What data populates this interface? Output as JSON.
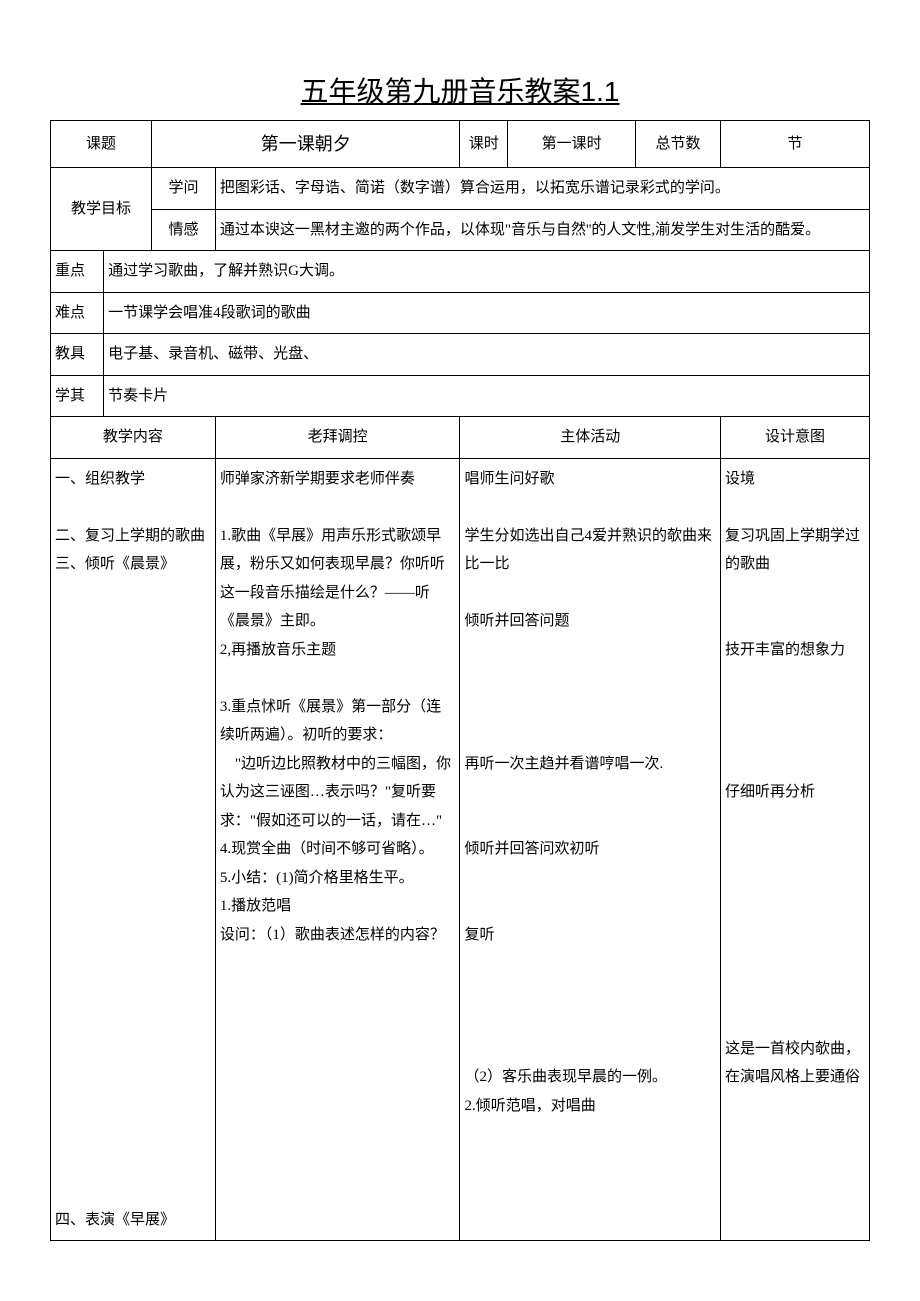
{
  "title": "五年级第九册音乐教案1.1",
  "header": {
    "topic_label": "课题",
    "topic_value": "第一课朝夕",
    "period_label": "课时",
    "period_value": "第一课时",
    "total_label": "总节数",
    "total_value": "节"
  },
  "goals": {
    "label": "教学目标",
    "knowledge_label": "学问",
    "knowledge_value": "把图彩话、字母诰、简诺（数字谱）算合运用，以拓宽乐谱记录彩式的学问。",
    "emotion_label": "情感",
    "emotion_value": "通过本谀这一黑材主邀的两个作品，以体现\"音乐与自然''的人文性,湔发学生对生活的酷爱。"
  },
  "rows": {
    "keypoint_label": "重点",
    "keypoint_value": "通过学习歌曲，了解并熟识G大调。",
    "difficulty_label": "难点",
    "difficulty_value": "一节课学会唱准4段歌词的歌曲",
    "tools_label": "教具",
    "tools_value": "电子基、录音机、磁带、光盘、",
    "learn_label": "学其",
    "learn_value": "节奏卡片"
  },
  "cols": {
    "c1": "教学内容",
    "c2": "老拜调控",
    "c3": "主体活动",
    "c4": "设计意图"
  },
  "body": {
    "c1": "一、组织教学\n\n二、复习上学期的歌曲\n三、倾听《晨景》\n\n\n\n\n\n\n\n\n\n\n\n\n\n\n\n\n\n\n\n\n\n\n四、表演《早展》",
    "c2": "师弹家济新学期要求老师伴奏\n\n1.歌曲《早展》用声乐形式歌颂早展，粉乐又如何表现早晨？你听听这一段音乐描绘是什么？——听　《晨景》主即。\n2,再播放音乐主题\n\n3.重点怵听《展景》第一部分（连续听两遍）。初听的要求：\n　\"边听边比照教材中的三幅图，你认为这三诬图…表示吗？\"复听要求：\"假如还可以的一话，请在…\"\n4.现赏全曲（时间不够可省略）。\n5.小结：(1)简介格里格生平。\n1.播放范唱\n设问：（1）歌曲表述怎样的内容？",
    "c3": "唱师生问好歌\n\n学生分如选出自己4爱并熟识的欹曲来比一比\n\n倾听并回答问题\n\n\n\n\n再听一次主趋并看谱哼唱一次.\n\n\n倾听并回答问欢初听\n\n\n复听\n\n\n\n\n（2）客乐曲表现早晨的一例。\n2.倾听范唱，对唱曲",
    "c4": "设境\n\n复习巩固上学期学过的歌曲\n\n\n技开丰富的想象力\n\n\n\n\n仔细听再分析\n\n\n\n\n\n\n\n\n这是一首校内欹曲，在演唱风格上要通俗"
  }
}
